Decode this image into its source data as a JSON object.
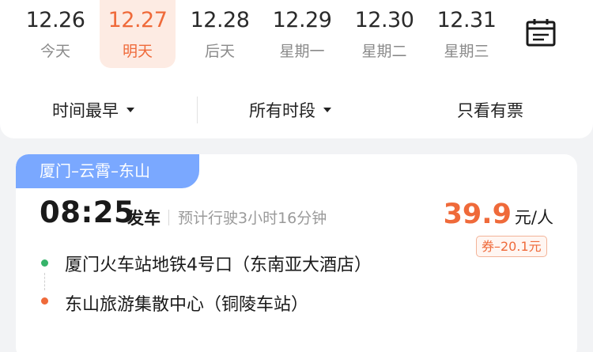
{
  "date_tabs": [
    {
      "date": "12.26",
      "weekday": "今天",
      "active": false
    },
    {
      "date": "12.27",
      "weekday": "明天",
      "active": true
    },
    {
      "date": "12.28",
      "weekday": "后天",
      "active": false
    },
    {
      "date": "12.29",
      "weekday": "星期一",
      "active": false
    },
    {
      "date": "12.30",
      "weekday": "星期二",
      "active": false
    },
    {
      "date": "12.31",
      "weekday": "星期三",
      "active": false
    }
  ],
  "calendar_icon": "calendar-icon",
  "filters": {
    "sort_label": "时间最早",
    "period_label": "所有时段",
    "available_only_label": "只看有票"
  },
  "route": {
    "tag": "厦门–云霄–东山",
    "departure_time": "08:25",
    "departure_label": "发车",
    "duration": "预计行驶3小时16分钟",
    "price_value": "39.9",
    "price_unit": "元/人",
    "coupon": "券–20.1元",
    "from_station": "厦门火车站地铁4号口（东南亚大酒店）",
    "to_station": "东山旅游集散中心（铜陵车站）"
  },
  "colors": {
    "accent": "#ef6a3a",
    "active_tab_bg": "#fdebe3",
    "route_tag_bg": "#7aa8ff",
    "from_dot": "#36b36a",
    "to_dot": "#ef6a3a"
  }
}
